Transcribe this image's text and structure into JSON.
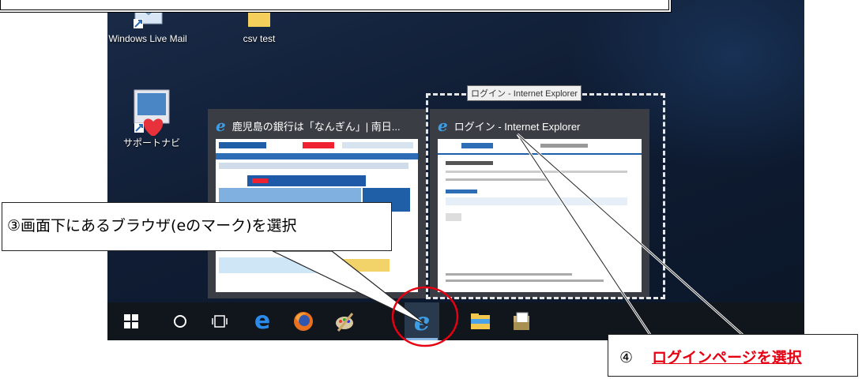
{
  "desktop": {
    "icons": [
      {
        "label": "Windows Live Mail",
        "icon": "windows-live-mail-icon"
      },
      {
        "label": "csv test",
        "icon": "folder-icon"
      },
      {
        "label": "サポートナビ",
        "icon": "support-navi-icon"
      }
    ]
  },
  "thumbnails": [
    {
      "title": "鹿児島の銀行は「なんぎん」| 南日...",
      "icon": "ie-icon"
    },
    {
      "title": "ログイン - Internet Explorer",
      "icon": "ie-icon"
    }
  ],
  "tooltip": "ログイン - Internet Explorer",
  "taskbar": {
    "items": [
      "start-button",
      "cortana-search",
      "task-view",
      "edge",
      "firefox",
      "paint",
      "internet-explorer",
      "file-explorer",
      "documents"
    ]
  },
  "callouts": {
    "step3": "③画面下にあるブラウザ(eのマーク)を選択",
    "step4_number": "④",
    "step4_link": "ログインページを選択"
  },
  "colors": {
    "highlight_circle": "#e60012",
    "link_red": "#e60012",
    "ie_blue": "#3c9ee6"
  }
}
